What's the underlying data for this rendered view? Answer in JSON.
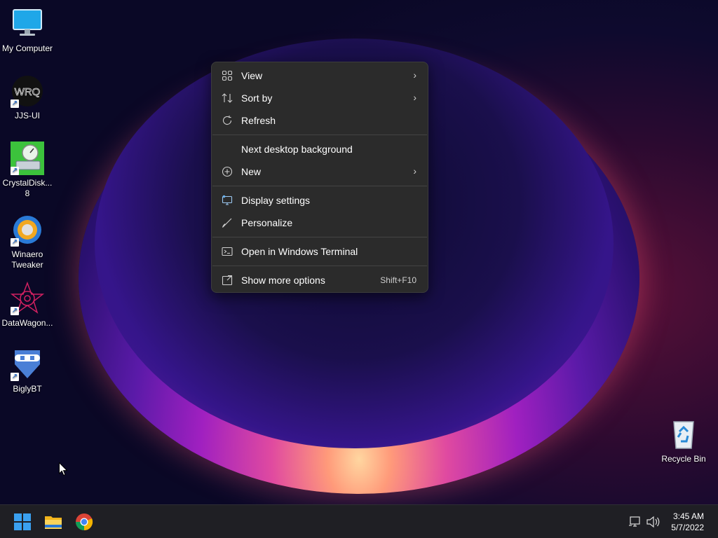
{
  "desktop": {
    "icons": [
      {
        "label": "My Computer",
        "icon": "monitor-icon"
      },
      {
        "label": "JJS-UI",
        "icon": "app-icon"
      },
      {
        "label": "CrystalDisk...",
        "label2": "8",
        "icon": "disk-icon"
      },
      {
        "label": "Winaero",
        "label2": "Tweaker",
        "icon": "winaero-icon"
      },
      {
        "label": "DataWagon...",
        "icon": "datawagon-icon"
      },
      {
        "label": "BiglyBT",
        "icon": "biglybt-icon"
      },
      {
        "label": "Recycle Bin",
        "icon": "recycle-bin-icon"
      }
    ],
    "jjs_logo_text": "WRQ"
  },
  "context_menu": {
    "items": [
      {
        "label": "View",
        "icon": "grid-icon",
        "submenu": true
      },
      {
        "label": "Sort by",
        "icon": "sort-icon",
        "submenu": true
      },
      {
        "label": "Refresh",
        "icon": "refresh-icon",
        "submenu": false
      },
      {
        "label": "Next desktop background",
        "icon": "",
        "submenu": false
      },
      {
        "label": "New",
        "icon": "plus-circle-icon",
        "submenu": true
      },
      {
        "label": "Display settings",
        "icon": "display-icon",
        "submenu": false
      },
      {
        "label": "Personalize",
        "icon": "brush-icon",
        "submenu": false
      },
      {
        "label": "Open in Windows Terminal",
        "icon": "terminal-icon",
        "submenu": false
      },
      {
        "label": "Show more options",
        "icon": "more-options-icon",
        "shortcut": "Shift+F10"
      }
    ],
    "chevron": "›"
  },
  "taskbar": {
    "apps": [
      "start-icon",
      "file-explorer-icon",
      "chrome-icon"
    ],
    "tray": [
      "network-icon",
      "volume-icon"
    ],
    "time": "3:45 AM",
    "date": "5/7/2022"
  },
  "colors": {
    "menu_bg": "#2b2b2b",
    "taskbar_bg": "#1f1f24",
    "accent": "#0078d4"
  }
}
